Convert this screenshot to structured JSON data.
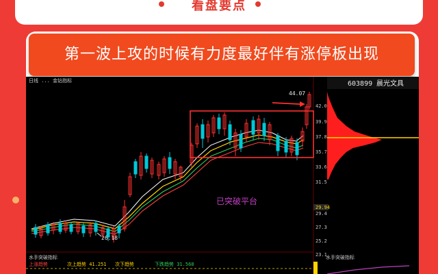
{
  "header": {
    "title": "看盘要点"
  },
  "banner": {
    "text": "第一波上攻的时候有力度最好伴有涨停板出现"
  },
  "chart": {
    "ticker": "603899",
    "name": "晨光文具",
    "price_label_high": "44.07",
    "price_label_low": "26.18",
    "annotation": "已突破平台",
    "top_info": "日线 ... 金钻指标",
    "indicator_panel_title": "水手突破指标",
    "indicator_labels": [
      "上涨趋势",
      "次上趋势 41.251",
      "次下趋势",
      "下跌趋势 31.568"
    ],
    "right_scale": [
      "42.0",
      "39.9",
      "37.8",
      "35.7",
      "33.6",
      "31.5",
      "29.94",
      "29.4",
      "27.3",
      "25.2",
      "23.1"
    ],
    "colors": {
      "up_candle": "#00c8d7",
      "down_candle": "#ff3030",
      "box": "#ff3030",
      "ma_white": "#ffffff",
      "ma_yellow": "#ffd400",
      "ma_green": "#2fd05f",
      "ma_red": "#ff4040",
      "volume_profile": "#ff2020",
      "annotation": "#c040c0"
    }
  }
}
